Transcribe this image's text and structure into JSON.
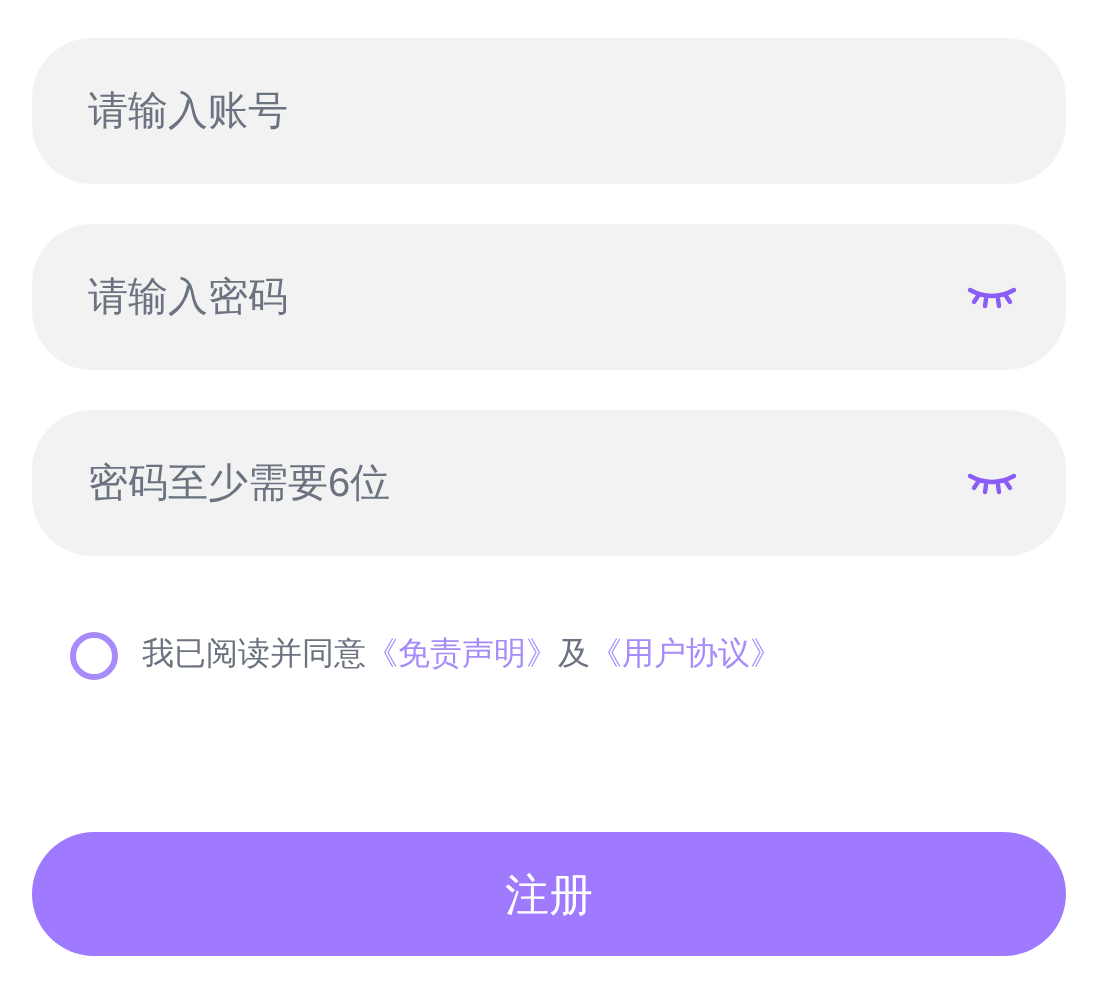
{
  "fields": [
    {
      "placeholder": "请输入账号",
      "kind": "text"
    },
    {
      "placeholder": "请输入密码",
      "kind": "password",
      "revealed": false
    },
    {
      "placeholder": "密码至少需要6位",
      "kind": "password",
      "revealed": false
    }
  ],
  "agreement": {
    "checked": false,
    "prefix": "我已阅读并同意",
    "link1": "《免责声明》",
    "joiner": "及",
    "link2": "《用户协议》"
  },
  "submit": "注册"
}
